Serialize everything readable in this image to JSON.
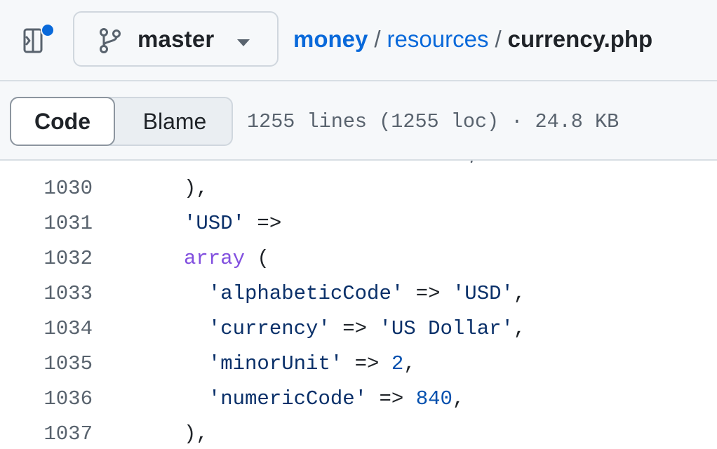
{
  "colors": {
    "accent_link": "#0969da",
    "notification_dot": "#0969da",
    "string": "#0a3069",
    "keyword": "#8250df",
    "number": "#0550ae",
    "text": "#1f2328",
    "muted": "#59636e"
  },
  "header": {
    "sidebar_toggle_icon": "sidebar-expand-icon",
    "branch": {
      "icon": "git-branch-icon",
      "label": "master",
      "caret_icon": "triangle-down-icon"
    },
    "breadcrumb": {
      "repo": "money",
      "sep1": "/",
      "folder": "resources",
      "sep2": "/",
      "file": "currency.php"
    }
  },
  "file_toolbar": {
    "tabs": [
      {
        "label": "Code",
        "selected": true
      },
      {
        "label": "Blame",
        "selected": false
      }
    ],
    "info": "1255 lines (1255 loc) · 24.8 KB"
  },
  "code": {
    "lines": [
      {
        "num": "1030",
        "tokens": [
          {
            "t": "),",
            "c": "punc"
          }
        ]
      },
      {
        "num": "1031",
        "tokens": [
          {
            "t": "'USD'",
            "c": "str"
          },
          {
            "t": " =>",
            "c": "op"
          }
        ]
      },
      {
        "num": "1032",
        "tokens": [
          {
            "t": "array",
            "c": "kw"
          },
          {
            "t": " (",
            "c": "punc"
          }
        ]
      },
      {
        "num": "1033",
        "tokens": [
          {
            "t": "  ",
            "c": "punc"
          },
          {
            "t": "'alphabeticCode'",
            "c": "str"
          },
          {
            "t": " => ",
            "c": "op"
          },
          {
            "t": "'USD'",
            "c": "str"
          },
          {
            "t": ",",
            "c": "punc"
          }
        ]
      },
      {
        "num": "1034",
        "tokens": [
          {
            "t": "  ",
            "c": "punc"
          },
          {
            "t": "'currency'",
            "c": "str"
          },
          {
            "t": " => ",
            "c": "op"
          },
          {
            "t": "'US Dollar'",
            "c": "str"
          },
          {
            "t": ",",
            "c": "punc"
          }
        ]
      },
      {
        "num": "1035",
        "tokens": [
          {
            "t": "  ",
            "c": "punc"
          },
          {
            "t": "'minorUnit'",
            "c": "str"
          },
          {
            "t": " => ",
            "c": "op"
          },
          {
            "t": "2",
            "c": "num"
          },
          {
            "t": ",",
            "c": "punc"
          }
        ]
      },
      {
        "num": "1036",
        "tokens": [
          {
            "t": "  ",
            "c": "punc"
          },
          {
            "t": "'numericCode'",
            "c": "str"
          },
          {
            "t": " => ",
            "c": "op"
          },
          {
            "t": "840",
            "c": "num"
          },
          {
            "t": ",",
            "c": "punc"
          }
        ]
      },
      {
        "num": "1037",
        "tokens": [
          {
            "t": "),",
            "c": "punc"
          }
        ]
      }
    ]
  }
}
